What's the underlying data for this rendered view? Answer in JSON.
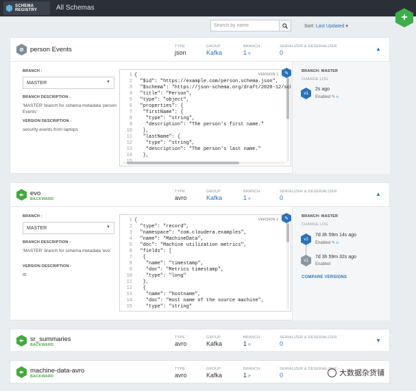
{
  "topbar": {
    "logo_line1": "SCHEMA",
    "logo_line2": "REGISTRY",
    "title": "All Schemas",
    "add_label": "+"
  },
  "toolbar": {
    "search_placeholder": "Search by name",
    "search_value": "",
    "sort_label": "Sort:",
    "sort_value": "Last Updated",
    "sort_caret": "▾"
  },
  "labels": {
    "type": "TYPE",
    "group": "GROUP",
    "branch": "BRANCH",
    "serdes": "SERIALIZER & DESERIALIZER",
    "branch_field": "BRANCH :",
    "branch_desc": "BRANCH DESCRIPTION :",
    "version_desc": "VERSION DESCRIPTION :",
    "side_branch": "BRANCH: MASTER",
    "change_log": "CHANGE LOG",
    "compare": "COMPARE VERSIONS",
    "expand_up": "▲",
    "expand_down": "▼",
    "edit_icon": "✎",
    "branch_icon": "⥼"
  },
  "schemas": [
    {
      "name": "person Events",
      "state": "",
      "icon": "⊘",
      "type": "json",
      "group": "Kafka",
      "branch": "1",
      "serdes": "0",
      "branch_select": "MASTER",
      "branch_description": "'MASTER' branch for schema metadata 'person Events'",
      "version_description": "security events from laptops",
      "version_label": "VERSION 1",
      "code": [
        {
          "n": "1",
          "t": "{"
        },
        {
          "n": "2",
          "t": "  \"$id\": \"https://example.com/person.schema.json\","
        },
        {
          "n": "3",
          "t": "  \"$schema\": \"https://json-schema.org/draft/2020-12/sche"
        },
        {
          "n": "4",
          "t": "  \"title\": \"Person\","
        },
        {
          "n": "5",
          "t": "  \"type\": \"object\","
        },
        {
          "n": "6",
          "t": "  \"properties\": {"
        },
        {
          "n": "7",
          "t": "   \"firstName\": {"
        },
        {
          "n": "8",
          "t": "    \"type\": \"string\","
        },
        {
          "n": "9",
          "t": "    \"description\": \"The person's first name.\""
        },
        {
          "n": "10",
          "t": "   },"
        },
        {
          "n": "11",
          "t": "   \"lastName\": {"
        },
        {
          "n": "12",
          "t": "    \"type\": \"string\","
        },
        {
          "n": "13",
          "t": "    \"description\": \"The person's last name.\""
        },
        {
          "n": "14",
          "t": "   },"
        },
        {
          "n": "15",
          "t": ""
        }
      ],
      "versions": [
        {
          "tag": "v1",
          "time": "2s ago",
          "state": "Enabled"
        }
      ]
    },
    {
      "name": "evo",
      "state": "BACKWARD",
      "icon": "↞",
      "type": "avro",
      "group": "Kafka",
      "branch": "1",
      "serdes": "0",
      "branch_select": "MASTER",
      "branch_description": "'MASTER' branch for schema metadata 'evo'",
      "version_description": "ttt",
      "version_label": "VERSION 2",
      "code": [
        {
          "n": "1",
          "t": "{"
        },
        {
          "n": "2",
          "t": "  \"type\": \"record\","
        },
        {
          "n": "3",
          "t": "  \"namespace\": \"com.cloudera.examples\","
        },
        {
          "n": "4",
          "t": "  \"name\": \"MachineData\","
        },
        {
          "n": "5",
          "t": "  \"doc\": \"Machine utilization metrics\","
        },
        {
          "n": "6",
          "t": "  \"fields\": ["
        },
        {
          "n": "7",
          "t": "   {"
        },
        {
          "n": "8",
          "t": "    \"name\": \"timestamp\","
        },
        {
          "n": "9",
          "t": "    \"doc\": \"Metrics timestamp\","
        },
        {
          "n": "10",
          "t": "    \"type\": \"long\""
        },
        {
          "n": "11",
          "t": "   },"
        },
        {
          "n": "12",
          "t": "   {"
        },
        {
          "n": "13",
          "t": "    \"name\": \"hostname\","
        },
        {
          "n": "14",
          "t": "    \"doc\": \"Host name of the source machine\","
        },
        {
          "n": "15",
          "t": "    \"type\": \"string\""
        }
      ],
      "versions": [
        {
          "tag": "v2",
          "time": "7d 3h 59m 14s ago",
          "state": "Enabled"
        },
        {
          "tag": "v1",
          "time": "7d 3h 59m 32s ago",
          "state": "Enabled"
        }
      ]
    },
    {
      "name": "sr_summaries",
      "state": "BACKWARD",
      "icon": "↞",
      "type": "avro",
      "group": "Kafka",
      "branch": "1",
      "serdes": "0"
    },
    {
      "name": "machine-data-avro",
      "state": "BACKWARD",
      "icon": "↞",
      "type": "avro",
      "group": "Kafka",
      "branch": "1",
      "serdes": "0"
    }
  ],
  "watermark": "大数据杂货铺"
}
